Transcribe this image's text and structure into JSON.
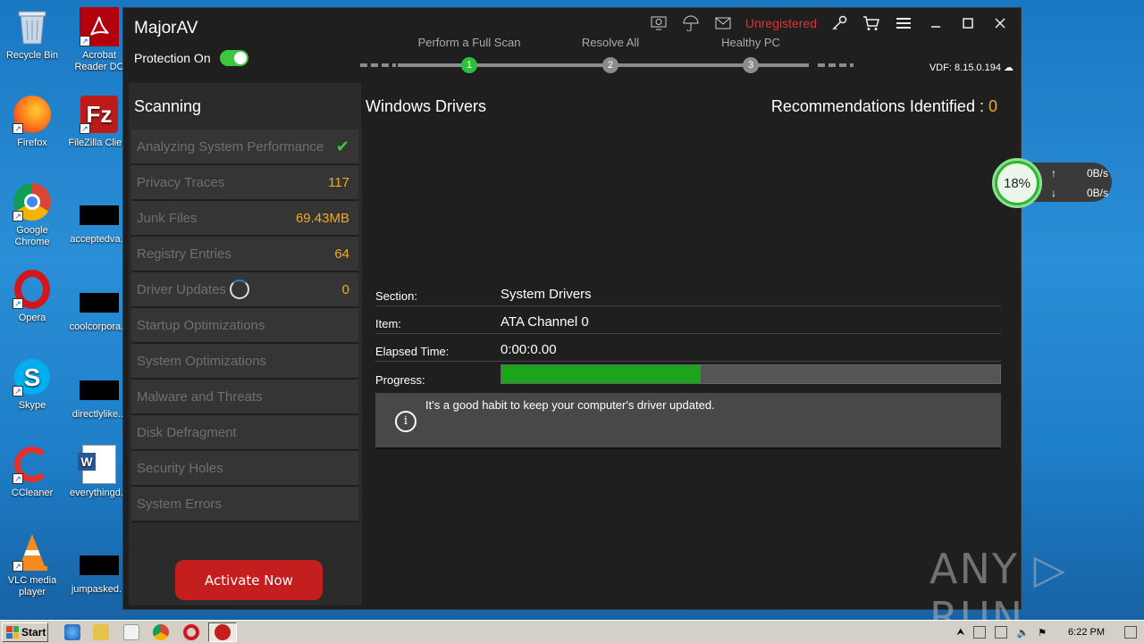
{
  "desktop": {
    "icons": [
      {
        "label": "Recycle Bin"
      },
      {
        "label": "Acrobat Reader DC"
      },
      {
        "label": "Firefox"
      },
      {
        "label": "FileZilla Client"
      },
      {
        "label": "Google Chrome"
      },
      {
        "label": "acceptedva..."
      },
      {
        "label": "Opera"
      },
      {
        "label": "coolcorpora..."
      },
      {
        "label": "Skype"
      },
      {
        "label": "directlylike..."
      },
      {
        "label": "CCleaner"
      },
      {
        "label": "everythingd..."
      },
      {
        "label": "VLC media player"
      },
      {
        "label": "jumpasked..."
      }
    ]
  },
  "app": {
    "title": "MajorAV",
    "protection_label": "Protection On",
    "protection_enabled": true,
    "registration_status": "Unregistered",
    "vdf": "VDF: 8.15.0.194",
    "steps": [
      {
        "label": "Perform a Full Scan",
        "number": "1",
        "active": true
      },
      {
        "label": "Resolve All",
        "number": "2",
        "active": false
      },
      {
        "label": "Healthy PC",
        "number": "3",
        "active": false
      }
    ],
    "sidebar": {
      "title": "Scanning",
      "items": [
        {
          "label": "Analyzing System Performance",
          "value": "",
          "status": "done"
        },
        {
          "label": "Privacy Traces",
          "value": "117"
        },
        {
          "label": "Junk Files",
          "value": "69.43MB"
        },
        {
          "label": "Registry Entries",
          "value": "64"
        },
        {
          "label": "Driver Updates",
          "value": "0",
          "status": "in-progress"
        },
        {
          "label": "Startup Optimizations",
          "value": ""
        },
        {
          "label": "System Optimizations",
          "value": ""
        },
        {
          "label": "Malware and Threats",
          "value": ""
        },
        {
          "label": "Disk Defragment",
          "value": ""
        },
        {
          "label": "Security Holes",
          "value": ""
        },
        {
          "label": "System Errors",
          "value": ""
        }
      ],
      "activate_label": "Activate Now"
    },
    "main": {
      "title": "Windows Drivers",
      "recommendations_label": "Recommendations Identified :",
      "recommendations_count": "0",
      "section_key": "Section:",
      "section_value": "System Drivers",
      "item_key": "Item:",
      "item_value": "ATA Channel 0",
      "elapsed_key": "Elapsed Time:",
      "elapsed_value": "0:00:0.00",
      "progress_key": "Progress:",
      "progress_fraction": 0.4,
      "tip": "It's a good habit to keep your computer's driver updated."
    }
  },
  "net_monitor": {
    "cpu_percent": "18%",
    "upload": "0B/s",
    "download": "0B/s",
    "up_arrow": "↑",
    "down_arrow": "↓"
  },
  "watermark": "ANY ▷ RUN",
  "taskbar": {
    "start_label": "Start",
    "clock": "6:22 PM"
  },
  "colors": {
    "accent_green": "#2fbf3a",
    "accent_orange": "#f0a92a",
    "alert_red": "#e53030",
    "button_red": "#c41e1e"
  }
}
